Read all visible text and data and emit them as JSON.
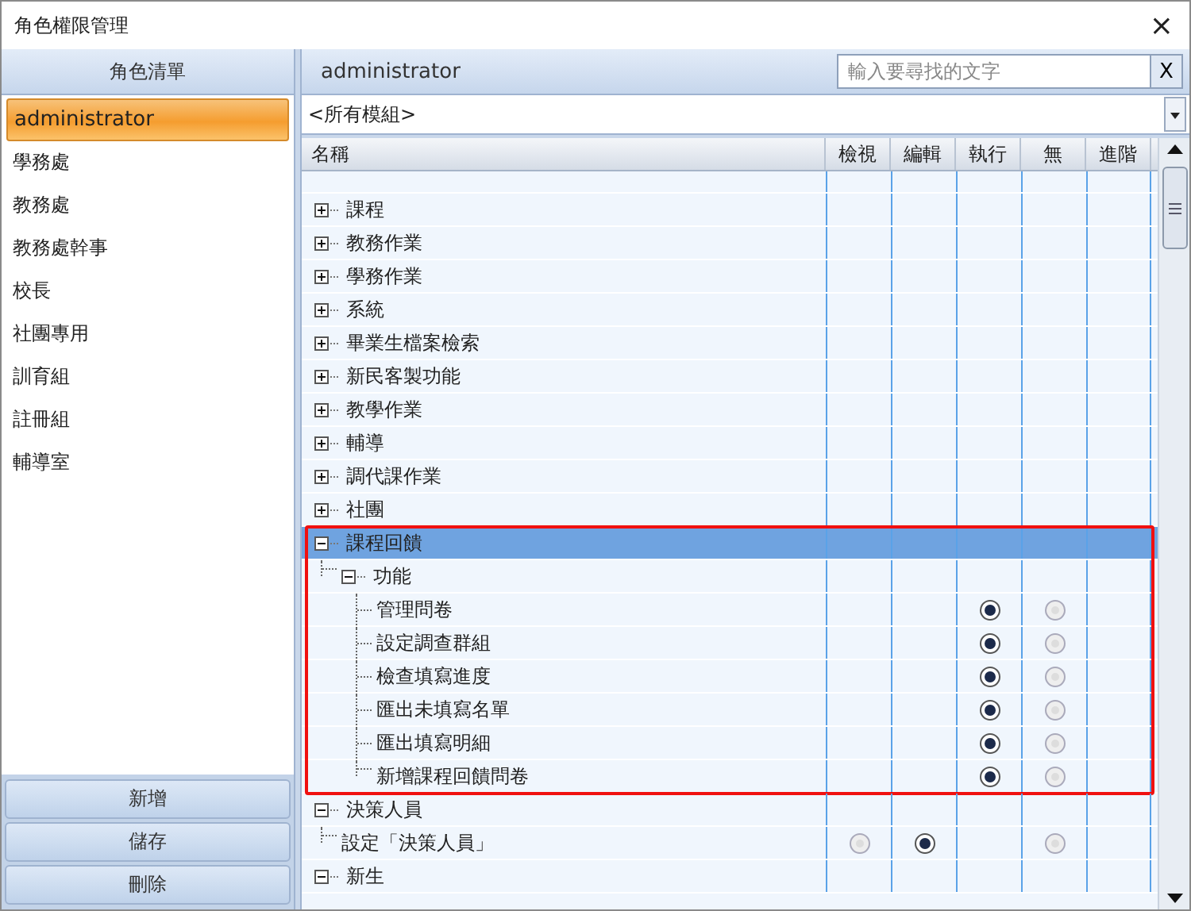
{
  "window": {
    "title": "角色權限管理",
    "close": "×"
  },
  "role_list": {
    "title": "角色清單",
    "items": [
      {
        "label": "administrator",
        "selected": true
      },
      {
        "label": "學務處",
        "selected": false
      },
      {
        "label": "教務處",
        "selected": false
      },
      {
        "label": "教務處幹事",
        "selected": false
      },
      {
        "label": "校長",
        "selected": false
      },
      {
        "label": "社團專用",
        "selected": false
      },
      {
        "label": "訓育組",
        "selected": false
      },
      {
        "label": "註冊組",
        "selected": false
      },
      {
        "label": "輔導室",
        "selected": false
      }
    ]
  },
  "buttons": [
    "新增",
    "儲存",
    "刪除"
  ],
  "detail": {
    "role": "administrator",
    "search": {
      "placeholder": "輸入要尋找的文字"
    },
    "clear_button": "X",
    "module_filter": "<所有模組>",
    "columns": [
      "名稱",
      "檢視",
      "編輯",
      "執行",
      "無",
      "進階"
    ],
    "tree": [
      {
        "label": "課程",
        "expanded": false,
        "selected": false
      },
      {
        "label": "教務作業",
        "expanded": false,
        "selected": false
      },
      {
        "label": "學務作業",
        "expanded": false,
        "selected": false
      },
      {
        "label": "系統",
        "expanded": false,
        "selected": false
      },
      {
        "label": "畢業生檔案檢索",
        "expanded": false,
        "selected": false
      },
      {
        "label": "新民客製功能",
        "expanded": false,
        "selected": false
      },
      {
        "label": "教學作業",
        "expanded": false,
        "selected": false
      },
      {
        "label": "輔導",
        "expanded": false,
        "selected": false
      },
      {
        "label": "調代課作業",
        "expanded": false,
        "selected": false
      },
      {
        "label": "社團",
        "expanded": false,
        "selected": false
      },
      {
        "label": "課程回饋",
        "expanded": true,
        "selected": true,
        "highlighted": true,
        "children": [
          {
            "label": "功能",
            "expanded": true,
            "selected": false,
            "children": [
              {
                "label": "管理問卷",
                "selected": false,
                "execute": {
                  "selected": true
                },
                "none": {
                  "selected": false
                }
              },
              {
                "label": "設定調查群組",
                "selected": false,
                "execute": {
                  "selected": true
                },
                "none": {
                  "selected": false
                }
              },
              {
                "label": "檢查填寫進度",
                "selected": false,
                "execute": {
                  "selected": true
                },
                "none": {
                  "selected": false
                }
              },
              {
                "label": "匯出未填寫名單",
                "selected": false,
                "execute": {
                  "selected": true
                },
                "none": {
                  "selected": false
                }
              },
              {
                "label": "匯出填寫明細",
                "selected": false,
                "execute": {
                  "selected": true
                },
                "none": {
                  "selected": false
                }
              },
              {
                "label": "新增課程回饋問卷",
                "selected": false,
                "execute": {
                  "selected": true
                },
                "none": {
                  "selected": false
                }
              }
            ]
          }
        ]
      },
      {
        "label": "決策人員",
        "expanded": true,
        "selected": false,
        "children": [
          {
            "label": "設定「決策人員」",
            "selected": false,
            "view": {
              "selected": false
            },
            "edit": {
              "selected": true
            },
            "none": {
              "selected": false
            }
          }
        ]
      },
      {
        "label": "新生",
        "expanded": true,
        "selected": false
      }
    ]
  }
}
